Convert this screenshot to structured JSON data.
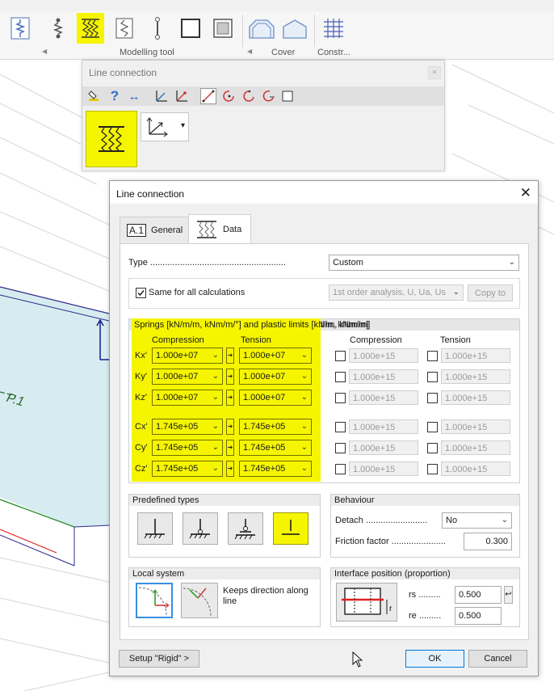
{
  "ribbon": {
    "group_labels": [
      "Modelling tool",
      "Cover",
      "Constr..."
    ]
  },
  "viewport": {
    "plate_label": "P.1"
  },
  "line_tool": {
    "title": "Line connection",
    "close": "×"
  },
  "dialog": {
    "title": "Line connection",
    "close": "✕",
    "tabs": {
      "general_icon_text": "A.1",
      "general_label": "General",
      "data_label": "Data"
    },
    "type_label": "Type .......................................................",
    "type_value": "Custom",
    "same_for_all_label": "Same for all calculations",
    "same_for_all_checked": true,
    "analysis_value": "1st order analysis, U, Ua, Us",
    "copy_to_label": "Copy to",
    "springs": {
      "header": "Springs [kN/m/m, kNm/m/°] and plastic limits [kN/m, kNm/m]",
      "col_compression": "Compression",
      "col_tension": "Tension",
      "col_compression_limit": "Compression",
      "col_tension_limit": "Tension",
      "rows": [
        {
          "label": "Kx'",
          "compression": "1.000e+07",
          "tension": "1.000e+07",
          "limit_compression": "1.000e+15",
          "limit_tension": "1.000e+15"
        },
        {
          "label": "Ky'",
          "compression": "1.000e+07",
          "tension": "1.000e+07",
          "limit_compression": "1.000e+15",
          "limit_tension": "1.000e+15"
        },
        {
          "label": "Kz'",
          "compression": "1.000e+07",
          "tension": "1.000e+07",
          "limit_compression": "1.000e+15",
          "limit_tension": "1.000e+15"
        },
        {
          "label": "Cx'",
          "compression": "1.745e+05",
          "tension": "1.745e+05",
          "limit_compression": "1.000e+15",
          "limit_tension": "1.000e+15"
        },
        {
          "label": "Cy'",
          "compression": "1.745e+05",
          "tension": "1.745e+05",
          "limit_compression": "1.000e+15",
          "limit_tension": "1.000e+15"
        },
        {
          "label": "Cz'",
          "compression": "1.745e+05",
          "tension": "1.745e+05",
          "limit_compression": "1.000e+15",
          "limit_tension": "1.000e+15"
        }
      ]
    },
    "predefined": {
      "header": "Predefined types"
    },
    "behaviour": {
      "header": "Behaviour",
      "detach_label": "Detach .........................",
      "detach_value": "No",
      "friction_label": "Friction factor ......................",
      "friction_value": "0.300"
    },
    "local_system": {
      "header": "Local system",
      "keeps_text": "Keeps direction along line"
    },
    "interface": {
      "header": "Interface position (proportion)",
      "rs_label": "rs .........",
      "rs_value": "0.500",
      "re_label": "re .........",
      "re_value": "0.500"
    },
    "setup_rigid_label": "Setup \"Rigid\" >",
    "ok_label": "OK",
    "cancel_label": "Cancel"
  },
  "colors": {
    "highlight": "#f5f500",
    "plate_fill": "#d7ecf0",
    "ok_border": "#0078d7"
  }
}
